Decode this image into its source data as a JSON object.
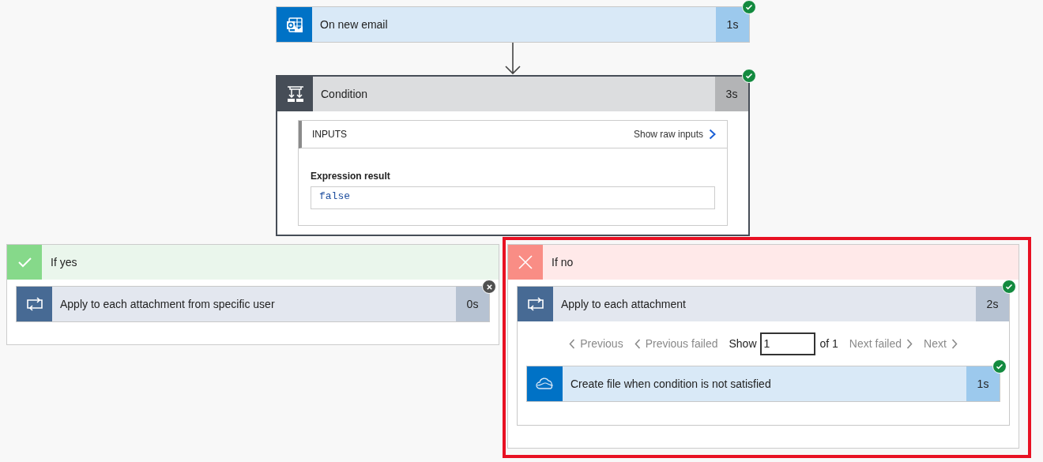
{
  "trigger": {
    "kind": "outlook",
    "title": "On new email",
    "duration": "1s",
    "succeeded": true
  },
  "condition": {
    "kind": "condition",
    "title": "Condition",
    "duration": "3s",
    "succeeded": true,
    "inputs": {
      "heading": "INPUTS",
      "link": "Show raw inputs",
      "label": "Expression result",
      "value": "false"
    }
  },
  "branches": [
    {
      "kind": "yes",
      "title": "If yes",
      "highlighted": false,
      "actions": [
        {
          "kind": "foreach",
          "title": "Apply to each attachment from specific user",
          "duration": "0s",
          "succeeded": false
        }
      ]
    },
    {
      "kind": "no",
      "title": "If no",
      "highlighted": true,
      "actions": [
        {
          "kind": "foreach",
          "title": "Apply to each attachment",
          "duration": "2s",
          "succeeded": true,
          "pager": {
            "previous": [
              {
                "label": "Previous",
                "disabled": true
              },
              {
                "label": "Previous failed",
                "disabled": true
              }
            ],
            "show": "Show",
            "value": "1",
            "total": "of 1",
            "next": [
              {
                "label": "Next failed",
                "disabled": true
              },
              {
                "label": "Next",
                "disabled": true
              }
            ]
          },
          "actions": [
            {
              "kind": "onedrive",
              "title": "Create file when condition is not satisfied",
              "duration": "1s",
              "succeeded": true
            }
          ]
        }
      ]
    }
  ]
}
